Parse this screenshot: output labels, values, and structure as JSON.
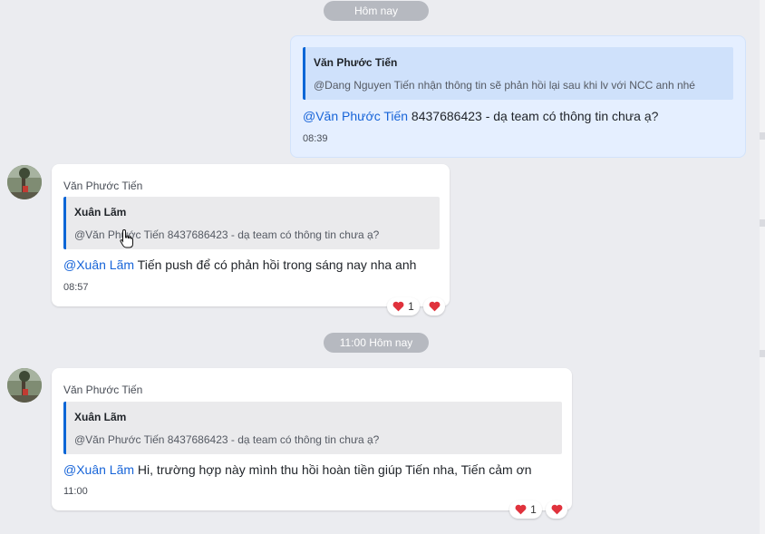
{
  "colors": {
    "mention": "#1764d8",
    "quote_bar": "#0b66d6",
    "heart": "#e0323c",
    "mine_bubble": "#e5efff"
  },
  "dates": {
    "today": "Hôm nay",
    "today_1100": "11:00 Hôm nay"
  },
  "messages": [
    {
      "mine": true,
      "quote_author": "Văn Phước Tiến",
      "quote_text": "@Dang Nguyen Tiến nhận thông tin sẽ phản hồi lại sau khi lv với NCC anh nhé",
      "mention": "@Văn Phước Tiến",
      "text": " 8437686423  - dạ team có thông tin chưa ạ?",
      "time": "08:39"
    },
    {
      "mine": false,
      "sender": "Văn Phước Tiến",
      "quote_author": "Xuân Lãm",
      "quote_text": "@Văn Phước Tiến 8437686423 - dạ team có thông tin chưa ạ?",
      "mention": "@Xuân Lãm",
      "text": " Tiến push để có phản hồi trong sáng nay nha anh",
      "time": "08:57",
      "reaction_icon": "heart-icon",
      "reaction_count": "1"
    },
    {
      "mine": false,
      "sender": "Văn Phước Tiến",
      "quote_author": "Xuân Lãm",
      "quote_text": "@Văn Phước Tiến 8437686423 - dạ team có thông tin chưa ạ?",
      "mention": "@Xuân Lãm",
      "text": " Hi, trường hợp này mình thu hồi hoàn tiền giúp Tiến nha, Tiến cảm ơn",
      "time": "11:00",
      "reaction_icon": "heart-icon",
      "reaction_count": "1"
    }
  ]
}
